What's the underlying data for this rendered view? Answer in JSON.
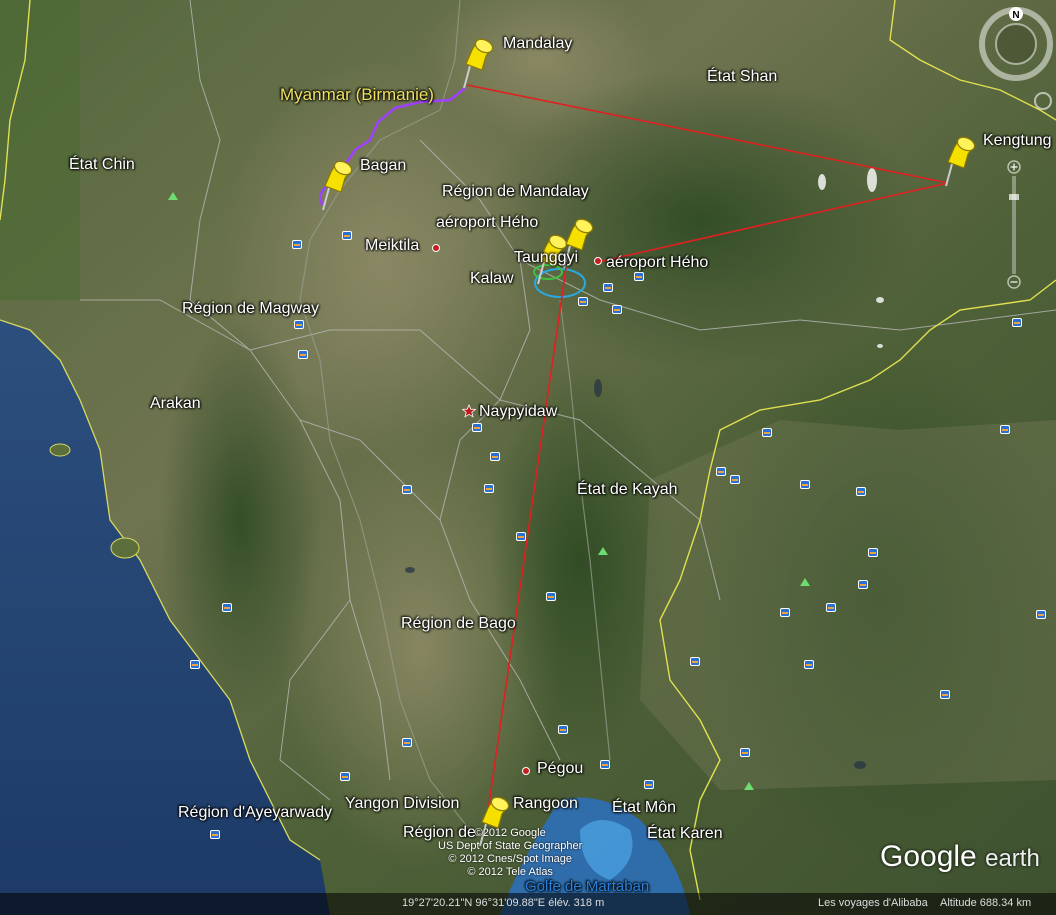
{
  "labels": {
    "mandalay": "Mandalay",
    "myanmar": "Myanmar (Birmanie)",
    "etat_shan": "État Shan",
    "kengtung": "Kengtung",
    "etat_chin": "État Chin",
    "bagan": "Bagan",
    "region_mandalay": "Région de Mandalay",
    "aeroport_heho_1": "aéroport Hého",
    "meiktila": "Meiktila",
    "taunggyi": "Taunggyi",
    "aeroport_heho_2": "aéroport Hého",
    "kalaw": "Kalaw",
    "region_magway": "Région de Magway",
    "arakan": "Arakan",
    "naypyidaw": "Naypyidaw",
    "etat_kayah": "État de Kayah",
    "region_bago": "Région de Bago",
    "pegou": "Pégou",
    "ayeyarwady": "Région d'Ayeyarwady",
    "yangon_division": "Yangon Division",
    "rangoon": "Rangoon",
    "etat_mon": "État Môn",
    "region_de": "Région de",
    "etat_karen": "État Karen",
    "golfe": "Golfe de Martaban"
  },
  "credits": {
    "line1": "©2012 Google",
    "line2": "US Dept of State Geographer",
    "line3": "© 2012 Cnes/Spot Image",
    "line4": "© 2012 Tele Atlas"
  },
  "status_bar": {
    "coordinates": "19°27'20.21\"N  96°31'09.88\"E  élév.  318 m",
    "tour_title": "Les voyages d'Alibaba",
    "altitude": "Altitude  688.34 km"
  },
  "logo": {
    "google": "Google",
    "earth": "earth"
  },
  "compass": {
    "north": "N"
  },
  "colors": {
    "route_line": "#e02020",
    "purple_track": "#a040ff",
    "pin_yellow": "#f5e000"
  }
}
